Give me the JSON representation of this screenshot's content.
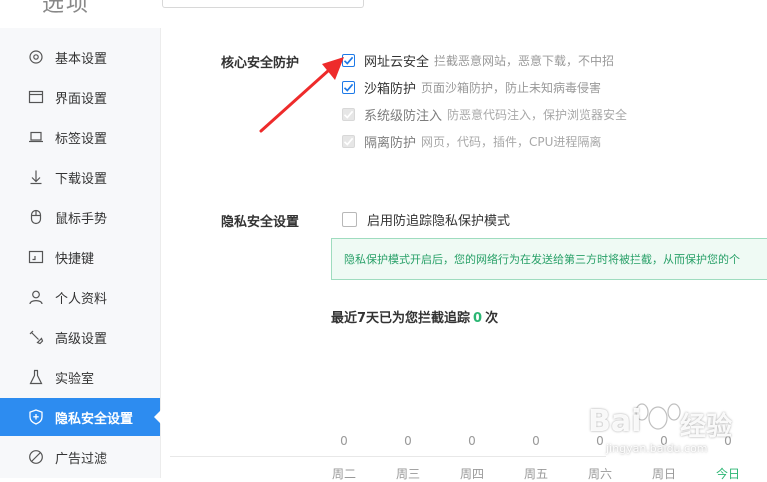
{
  "header": {
    "app_title_fragment": "选项"
  },
  "sidebar": {
    "items": [
      {
        "label": "基本设置",
        "icon": "settings-icon"
      },
      {
        "label": "界面设置",
        "icon": "window-icon"
      },
      {
        "label": "标签设置",
        "icon": "laptop-icon"
      },
      {
        "label": "下载设置",
        "icon": "download-icon"
      },
      {
        "label": "鼠标手势",
        "icon": "mouse-icon"
      },
      {
        "label": "快捷键",
        "icon": "shortcut-icon"
      },
      {
        "label": "个人资料",
        "icon": "user-icon"
      },
      {
        "label": "高级设置",
        "icon": "wrench-icon"
      },
      {
        "label": "实验室",
        "icon": "flask-icon"
      },
      {
        "label": "隐私安全设置",
        "icon": "shield-icon",
        "active": true
      },
      {
        "label": "广告过滤",
        "icon": "ban-icon"
      }
    ]
  },
  "core_security": {
    "title": "核心安全防护",
    "options": [
      {
        "title": "网址云安全",
        "desc": "拦截恶意网站，恶意下载，不中招",
        "checked": true,
        "disabled": false
      },
      {
        "title": "沙箱防护",
        "desc": "页面沙箱防护，防止未知病毒侵害",
        "checked": true,
        "disabled": false
      },
      {
        "title": "系统级防注入",
        "desc": "防恶意代码注入，保护浏览器安全",
        "checked": true,
        "disabled": true
      },
      {
        "title": "隔离防护",
        "desc": "网页，代码，插件，CPU进程隔离",
        "checked": true,
        "disabled": true
      }
    ]
  },
  "privacy": {
    "title": "隐私安全设置",
    "anti_tracking": {
      "label": "启用防追踪隐私保护模式",
      "checked": false
    },
    "notice": "隐私保护模式开启后，您的网络行为在发送给第三方时将被拦截，从而保护您的个"
  },
  "stats": {
    "prefix": "最近7天已为您拦截追踪",
    "count": "0",
    "suffix": "次"
  },
  "chart_data": {
    "type": "bar",
    "categories": [
      "周二",
      "周三",
      "周四",
      "周五",
      "周六",
      "周日",
      "今日"
    ],
    "values": [
      0,
      0,
      0,
      0,
      0,
      0,
      0
    ],
    "value_labels": [
      "0",
      "0",
      "0",
      "0",
      "0",
      "0",
      "0"
    ],
    "highlight_category": "今日",
    "highlight_color": "#2bb673"
  },
  "watermark": {
    "brand": "Bai",
    "brand2": "经验",
    "url": "jingyan.baidu.com"
  },
  "colors": {
    "accent": "#2d8cf0",
    "success": "#2bb673",
    "arrow": "#ee2b2b"
  }
}
